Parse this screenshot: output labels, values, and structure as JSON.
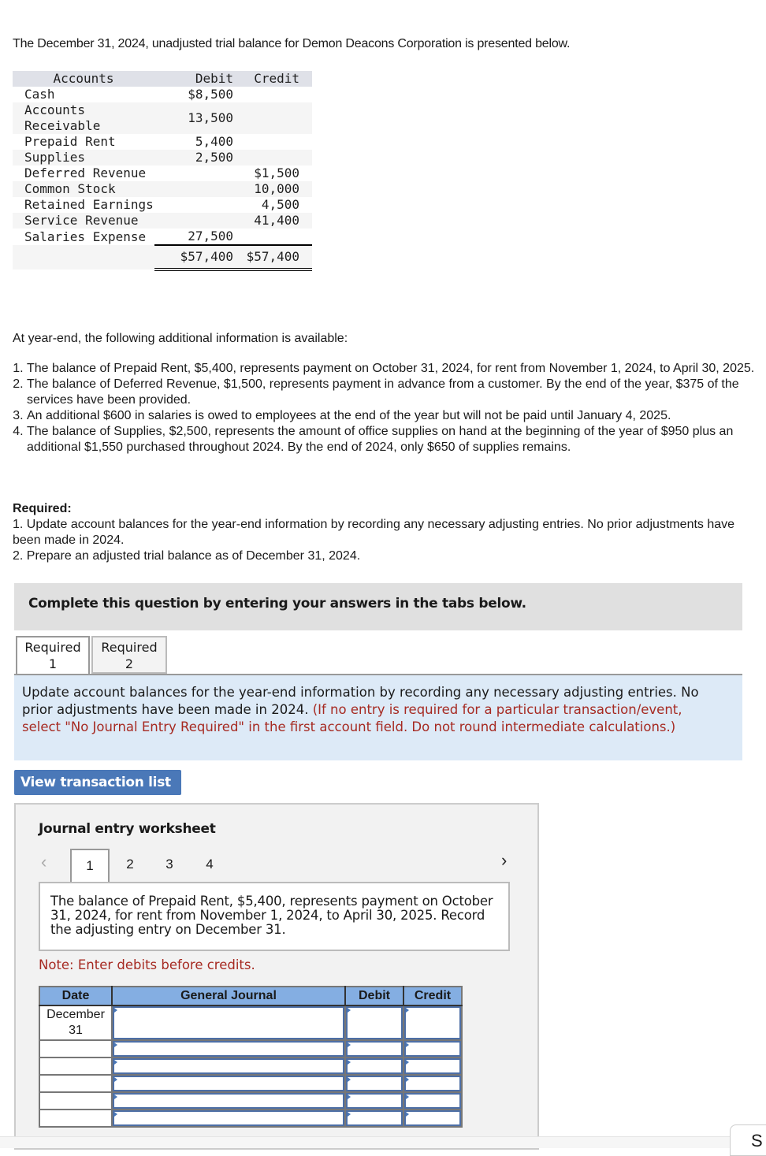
{
  "intro": "The December 31, 2024, unadjusted trial balance for Demon Deacons Corporation is presented below.",
  "trial_balance": {
    "headers": {
      "accounts": "Accounts",
      "debit": "Debit",
      "credit": "Credit"
    },
    "rows": [
      {
        "account": "Cash",
        "debit": "$8,500",
        "credit": ""
      },
      {
        "account": "Accounts Receivable",
        "debit": "13,500",
        "credit": ""
      },
      {
        "account": "Prepaid Rent",
        "debit": "5,400",
        "credit": ""
      },
      {
        "account": "Supplies",
        "debit": "2,500",
        "credit": ""
      },
      {
        "account": "Deferred Revenue",
        "debit": "",
        "credit": "$1,500"
      },
      {
        "account": "Common Stock",
        "debit": "",
        "credit": "10,000"
      },
      {
        "account": "Retained Earnings",
        "debit": "",
        "credit": "4,500"
      },
      {
        "account": "Service Revenue",
        "debit": "",
        "credit": "41,400"
      },
      {
        "account": "Salaries Expense",
        "debit": "27,500",
        "credit": ""
      }
    ],
    "totals": {
      "debit": "$57,400",
      "credit": "$57,400"
    }
  },
  "additional_info": {
    "intro": "At year-end, the following additional information is available:",
    "items": [
      "The balance of Prepaid Rent, $5,400, represents payment on October 31, 2024, for rent from November 1, 2024, to April 30, 2025.",
      "The balance of  Deferred Revenue, $1,500, represents payment in advance from a customer. By the end of the year, $375 of the services have been provided.",
      "An additional $600 in salaries is owed to employees at the end of the year but will not be paid until January 4, 2025.",
      "The balance of Supplies, $2,500, represents the amount of office supplies on hand at the beginning of the year of $950 plus an additional $1,550 purchased throughout 2024. By the end of 2024, only $650 of supplies remains."
    ]
  },
  "required": {
    "heading": "Required:",
    "items": [
      "1. Update account balances for the year-end information by recording any necessary adjusting entries. No prior adjustments have been made in 2024.",
      "2. Prepare an adjusted trial balance as of December 31, 2024."
    ]
  },
  "complete_banner": "Complete this question by entering your answers in the tabs below.",
  "tabs": [
    {
      "line1": "Required",
      "line2": "1",
      "active": true
    },
    {
      "line1": "Required",
      "line2": "2",
      "active": false
    }
  ],
  "instructions": {
    "main": "Update account balances for the year-end information by recording any necessary adjusting entries. No prior adjustments have been made in 2024. ",
    "note": "(If no entry is required for a particular transaction/event, select \"No Journal Entry Required\" in the first account field. Do not round intermediate calculations.)"
  },
  "view_transaction_list_label": "View transaction list",
  "worksheet": {
    "title": "Journal entry worksheet",
    "prev_icon": "‹",
    "next_icon": "›",
    "pages": [
      "1",
      "2",
      "3",
      "4"
    ],
    "active_page": "1",
    "description": "The balance of Prepaid Rent, $5,400, represents payment on October 31, 2024, for rent from November 1, 2024, to April 30, 2025. Record the adjusting entry on December 31.",
    "note": "Note: Enter debits before credits.",
    "table": {
      "headers": {
        "date": "Date",
        "general_journal": "General Journal",
        "debit": "Debit",
        "credit": "Credit"
      },
      "rows": [
        {
          "date": "December 31",
          "account": "",
          "debit": "",
          "credit": ""
        },
        {
          "date": "",
          "account": "",
          "debit": "",
          "credit": ""
        },
        {
          "date": "",
          "account": "",
          "debit": "",
          "credit": ""
        },
        {
          "date": "",
          "account": "",
          "debit": "",
          "credit": ""
        },
        {
          "date": "",
          "account": "",
          "debit": "",
          "credit": ""
        },
        {
          "date": "",
          "account": "",
          "debit": "",
          "credit": ""
        }
      ]
    }
  },
  "corner_button_partial": "S"
}
